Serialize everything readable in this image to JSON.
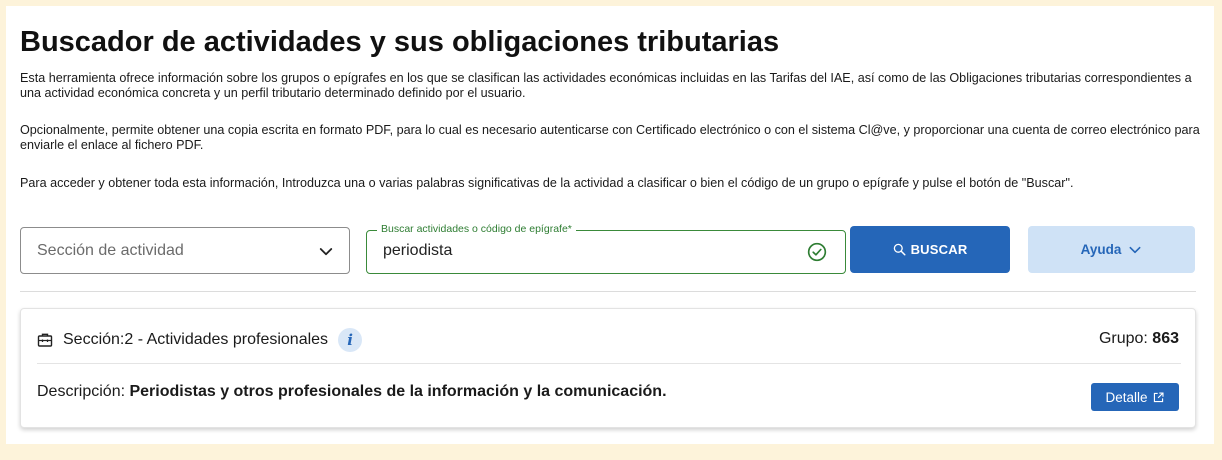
{
  "page": {
    "title": "Buscador de actividades y sus obligaciones tributarias",
    "paragraphs": [
      "Esta herramienta ofrece información sobre los grupos o epígrafes en los que se clasifican las actividades económicas incluidas en las Tarifas del IAE, así como de las Obligaciones tributarias correspondientes a una actividad económica concreta y un perfil tributario determinado definido por el usuario.",
      "Opcionalmente, permite obtener una copia escrita en formato PDF, para lo cual es necesario autenticarse con Certificado electrónico o con el sistema Cl@ve, y proporcionar una cuenta de correo electrónico para enviarle el enlace al fichero PDF.",
      "Para acceder y obtener toda esta información, Introduzca una o varias palabras significativas de la actividad a clasificar o bien el código de un grupo o epígrafe y pulse el botón de \"Buscar\"."
    ]
  },
  "search": {
    "section_select_placeholder": "Sección de actividad",
    "field_label": "Buscar actividades o código de epígrafe*",
    "field_value": "periodista",
    "buscar_label": "BUSCAR",
    "ayuda_label": "Ayuda"
  },
  "result": {
    "section_prefix": "Sección: ",
    "section_value": "2 - Actividades profesionales",
    "info_glyph": "i",
    "group_label": "Grupo: ",
    "group_value": "863",
    "description_label": "Descripción: ",
    "description_value": "Periodistas y otros profesionales de la información y la comunicación.",
    "detalle_label": "Detalle"
  },
  "icons": {
    "section_chevron": "chevron-down-icon",
    "valid_check": "check-circle-icon",
    "search": "search-icon",
    "ayuda_chevron": "chevron-down-icon",
    "section": "briefcase-icon",
    "info": "info-icon",
    "external": "external-link-icon"
  },
  "colors": {
    "page_background": "#fdf3da",
    "primary": "#2566b8",
    "secondary_button": "#cfe2f6",
    "valid_green": "#2e7d32",
    "info_background": "#d9e7f7"
  }
}
